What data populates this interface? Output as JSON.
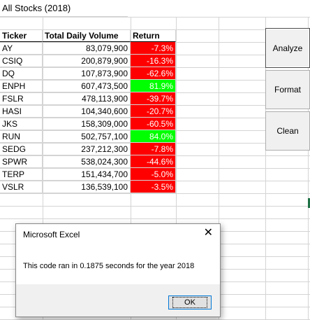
{
  "sheet_title": "All Stocks (2018)",
  "headers": {
    "ticker": "Ticker",
    "volume": "Total Daily Volume",
    "return": "Return"
  },
  "rows": [
    {
      "ticker": "AY",
      "volume": "83,079,900",
      "return": "-7.3%",
      "status": "negative"
    },
    {
      "ticker": "CSIQ",
      "volume": "200,879,900",
      "return": "-16.3%",
      "status": "negative"
    },
    {
      "ticker": "DQ",
      "volume": "107,873,900",
      "return": "-62.6%",
      "status": "negative"
    },
    {
      "ticker": "ENPH",
      "volume": "607,473,500",
      "return": "81.9%",
      "status": "positive"
    },
    {
      "ticker": "FSLR",
      "volume": "478,113,900",
      "return": "-39.7%",
      "status": "negative"
    },
    {
      "ticker": "HASI",
      "volume": "104,340,600",
      "return": "-20.7%",
      "status": "negative"
    },
    {
      "ticker": "JKS",
      "volume": "158,309,000",
      "return": "-60.5%",
      "status": "negative"
    },
    {
      "ticker": "RUN",
      "volume": "502,757,100",
      "return": "84.0%",
      "status": "positive"
    },
    {
      "ticker": "SEDG",
      "volume": "237,212,300",
      "return": "-7.8%",
      "status": "negative"
    },
    {
      "ticker": "SPWR",
      "volume": "538,024,300",
      "return": "-44.6%",
      "status": "negative"
    },
    {
      "ticker": "TERP",
      "volume": "151,434,700",
      "return": "-5.0%",
      "status": "negative"
    },
    {
      "ticker": "VSLR",
      "volume": "136,539,100",
      "return": "-3.5%",
      "status": "negative"
    }
  ],
  "buttons": {
    "analyze": "Analyze",
    "format": "Format",
    "clean": "Clean"
  },
  "dialog": {
    "title": "Microsoft Excel",
    "message": "This code ran in 0.1875 seconds for the year 2018",
    "ok_label": "OK"
  },
  "colors": {
    "negative": "#ff0000",
    "positive": "#00ff00",
    "header_border": "#000000"
  }
}
